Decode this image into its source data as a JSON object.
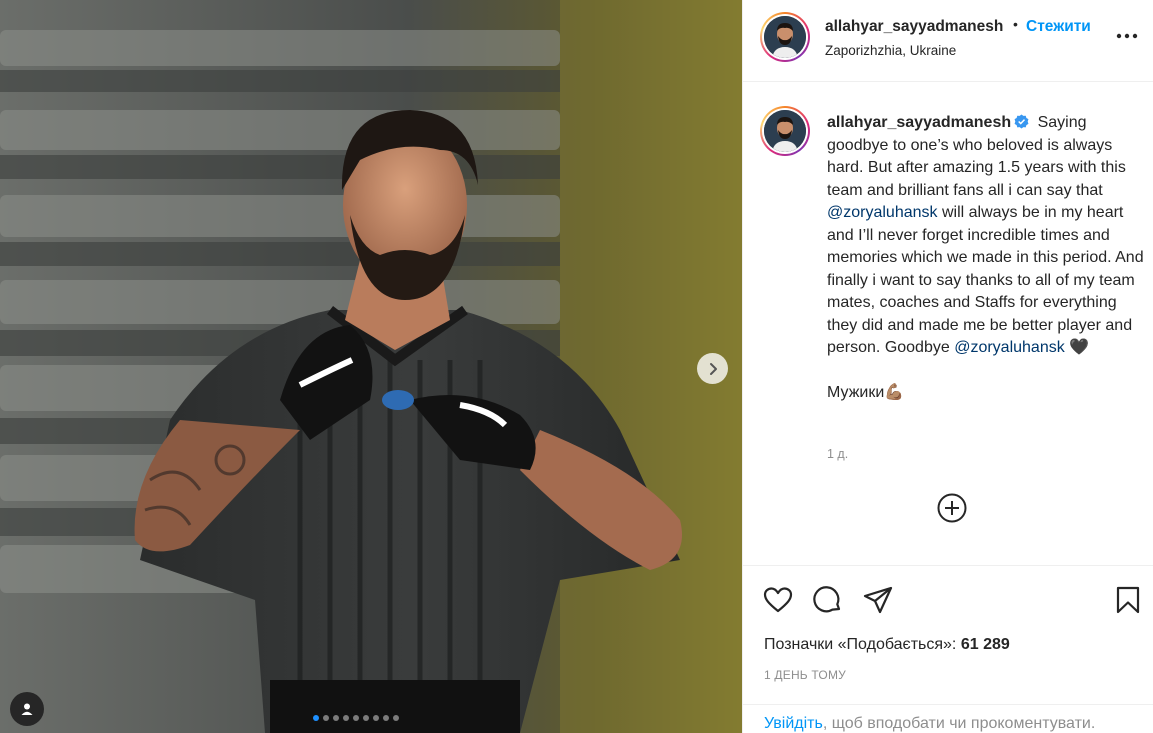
{
  "post": {
    "username": "allahyar_sayyadmanesh",
    "follow_label": "Стежити",
    "separator": "•",
    "location": "Zaporizhzhia, Ukraine",
    "caption": {
      "part1": "Saying goodbye to one’s who beloved is always hard. But after amazing 1.5 years with this team and brilliant fans all i can say that",
      "mention1": "@zoryaluhansk",
      "part2": "will always be in my heart and I’ll never forget incredible times and memories which we made in this period. And finally i want to say thanks to all of my team mates, coaches and Staffs for everything they did and made me be better player and person. Goodbye",
      "mention2": "@zoryaluhansk",
      "emoji_heart": "🖤",
      "line2": "Мужики",
      "emoji_muscle": "💪🏽"
    },
    "caption_time": "1 д.",
    "likes_label": "Позначки «Подобається»:",
    "likes_count": "61 289",
    "posted_ago": "1 ДЕНЬ ТОМУ",
    "login_link": "Увійдіть",
    "login_rest": ", щоб вподобати чи прокоментувати."
  },
  "carousel": {
    "total_slides": 9,
    "active_slide": 1
  },
  "colors": {
    "accent": "#0095f6",
    "mention": "#00376b",
    "muted": "#8e8e8e"
  },
  "icons": [
    "next-arrow-icon",
    "user-tag-icon",
    "more-options-icon",
    "verified-badge-icon",
    "add-comment-icon",
    "heart-icon",
    "comment-icon",
    "share-icon",
    "bookmark-icon"
  ]
}
